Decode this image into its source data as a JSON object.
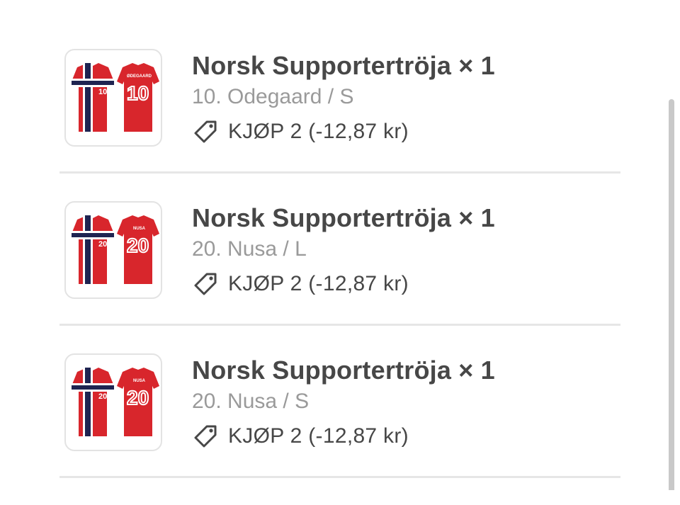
{
  "items": [
    {
      "title": "Norsk Supportertröja × 1",
      "variant": "10. Odegaard / S",
      "discount": "KJØP 2 (-12,87 kr)",
      "jersey_front_number": "10",
      "jersey_back_number": "10",
      "jersey_back_name": "ØDEGAARD"
    },
    {
      "title": "Norsk Supportertröja × 1",
      "variant": "20. Nusa / L",
      "discount": "KJØP 2 (-12,87 kr)",
      "jersey_front_number": "20",
      "jersey_back_number": "20",
      "jersey_back_name": "NUSA"
    },
    {
      "title": "Norsk Supportertröja × 1",
      "variant": "20. Nusa / S",
      "discount": "KJØP 2 (-12,87 kr)",
      "jersey_front_number": "20",
      "jersey_back_number": "20",
      "jersey_back_name": "NUSA"
    }
  ],
  "colors": {
    "title": "#474747",
    "variant": "#9a9a9a",
    "divider": "#e6e6e6",
    "jersey_red": "#d8262c",
    "jersey_navy": "#1f2451",
    "scrollbar": "#c9c9c9"
  },
  "icons": {
    "discount": "price-tag-icon"
  }
}
